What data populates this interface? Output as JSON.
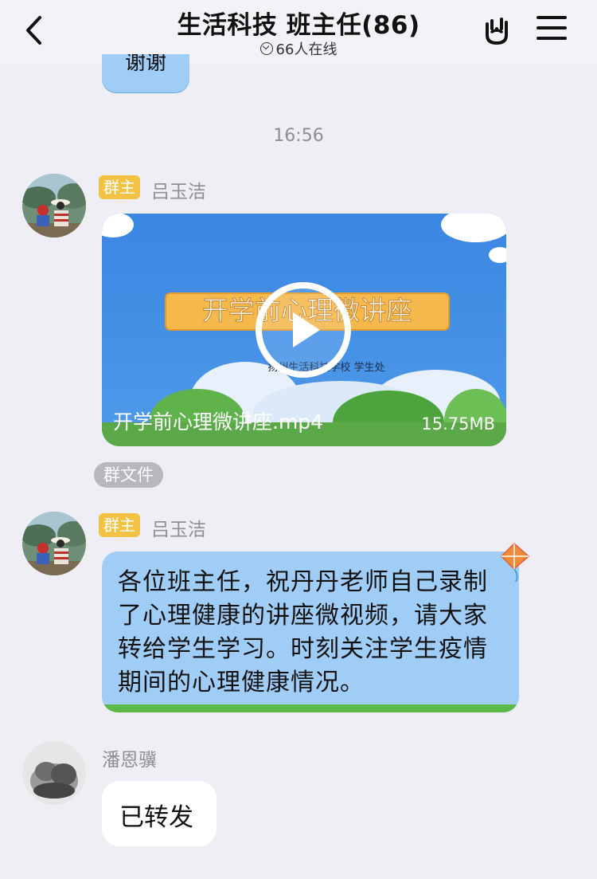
{
  "header": {
    "title": "生活科技 班主任(86)",
    "online": "66人在线"
  },
  "previous_message": {
    "text": "谢谢"
  },
  "timestamp": "16:56",
  "messages": [
    {
      "badge": "群主",
      "sender": "吕玉洁",
      "type": "video",
      "video": {
        "cover_title": "开学前心理微讲座",
        "cover_subtitle": "扬州生活科技学校 学生处",
        "filename": "开学前心理微讲座.mp4",
        "size": "15.75MB"
      },
      "tag": "群文件"
    },
    {
      "badge": "群主",
      "sender": "吕玉洁",
      "type": "text",
      "text": "各位班主任，祝丹丹老师自己录制了心理健康的讲座微视频，请大家转给学生学习。时刻关注学生疫情期间的心理健康情况。"
    },
    {
      "sender": "潘恩骥",
      "type": "text",
      "text": "已转发"
    }
  ],
  "colors": {
    "background": "#eeeef4",
    "bubble_blue": "#9fcdf6",
    "badge": "#f4c243",
    "video_sky": "#3f8fe6"
  }
}
